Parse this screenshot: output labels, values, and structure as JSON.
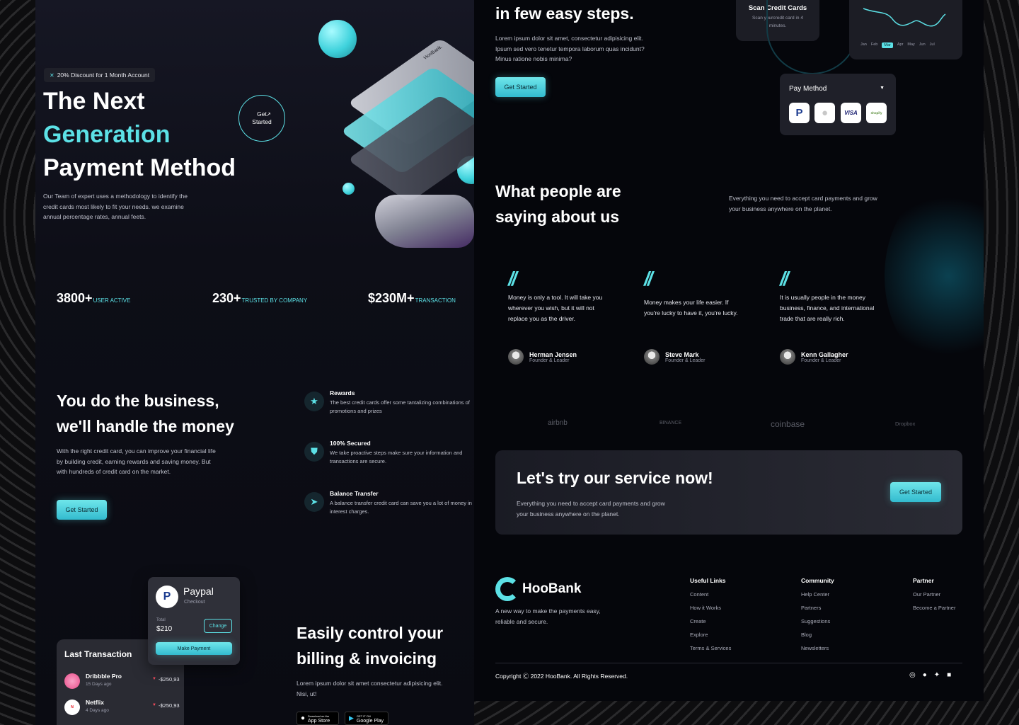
{
  "hero": {
    "badge": "20% Discount for 1 Month Account",
    "title_line1": "The Next",
    "title_line2": "Generation",
    "title_line3": "Payment Method",
    "description": "Our Team of expert uses a methodology to identify the credit cards most likely to fit your needs. we examine annual percentage rates, annual feets.",
    "circle_button": "Get Started",
    "card_brand": "HooBank"
  },
  "stats": [
    {
      "value": "3800+",
      "label": "USER ACTIVE"
    },
    {
      "value": "230+",
      "label": "TRUSTED BY COMPANY"
    },
    {
      "value": "$230M+",
      "label": "TRANSACTION"
    }
  ],
  "business": {
    "title_line1": "You do the business,",
    "title_line2": "we'll handle the money",
    "description": "With the right credit card, you can improve your financial life by building credit, earning rewards and saving money. But with hundreds of credit card on the market.",
    "button": "Get Started"
  },
  "features": [
    {
      "icon": "star-icon",
      "title": "Rewards",
      "desc": "The best credit cards offer some tantalizing combinations of promotions and prizes"
    },
    {
      "icon": "shield-icon",
      "title": "100% Secured",
      "desc": "We take proactive steps make sure your information and transactions are secure."
    },
    {
      "icon": "send-icon",
      "title": "Balance Transfer",
      "desc": "A balance transfer credit card can save you a lot of money in interest charges."
    }
  ],
  "paypal_card": {
    "title": "Paypal",
    "subtitle": "Checkout",
    "total_label": "Total",
    "total_value": "$210",
    "change_button": "Change",
    "pay_button": "Make Payment"
  },
  "last_transaction": {
    "title": "Last Transaction",
    "items": [
      {
        "name": "Dribbble Pro",
        "time": "15 Days ago",
        "amount": "-$250,93"
      },
      {
        "name": "Netflix",
        "time": "4 Days ago",
        "amount": "-$250,93"
      }
    ]
  },
  "billing": {
    "title_line1": "Easily control your",
    "title_line2": "billing & invoicing",
    "description": "Lorem ipsum dolor sit amet consectetur adipisicing elit. Nisi, ut!",
    "app_store_small": "Download on the",
    "app_store": "App Store",
    "google_play_small": "GET IT ON",
    "google_play": "Google Play"
  },
  "steps": {
    "title": "in few easy steps.",
    "description": "Lorem ipsum dolor sit amet, consectetur adipisicing elit. Ipsum sed vero tenetur tempora laborum quas incidunt? Minus ratione nobis minima?",
    "button": "Get Started"
  },
  "scan_card": {
    "title": "Scan Credit Cards",
    "desc": "Scan yourcredit card in 4 minutes."
  },
  "mini_chart": {
    "months": [
      "Jan",
      "Feb",
      "Mar",
      "Apr",
      "May",
      "Jun",
      "Jul"
    ],
    "active": "Mar"
  },
  "pay_method": {
    "title": "Pay Method",
    "methods": [
      "paypal-icon",
      "apple-icon",
      "visa-icon",
      "shopify-icon"
    ],
    "visa_text": "VISA",
    "shopify_text": "shopify"
  },
  "testimonials": {
    "title_line1": "What people are",
    "title_line2": "saying about us",
    "side_text": "Everything you need to accept card payments and grow your business anywhere on the planet.",
    "items": [
      {
        "text": "Money is only a tool. It will take you wherever you wish, but it will not replace you as the driver.",
        "name": "Herman Jensen",
        "role": "Founder & Leader"
      },
      {
        "text": "Money makes your life easier. If you're lucky to have it, you're lucky.",
        "name": "Steve Mark",
        "role": "Founder & Leader"
      },
      {
        "text": "It is usually people in the money business, finance, and international trade that are really rich.",
        "name": "Kenn Gallagher",
        "role": "Founder & Leader"
      }
    ]
  },
  "partners": [
    "airbnb",
    "BINANCE",
    "coinbase",
    "Dropbox"
  ],
  "cta": {
    "title": "Let's try our service now!",
    "description": "Everything you need to accept card payments and grow your business anywhere on the planet.",
    "button": "Get Started"
  },
  "footer": {
    "brand": "HooBank",
    "tagline": "A new way to make the payments easy, reliable and secure.",
    "columns": [
      {
        "title": "Useful Links",
        "links": [
          "Content",
          "How it Works",
          "Create",
          "Explore",
          "Terms & Services"
        ]
      },
      {
        "title": "Community",
        "links": [
          "Help Center",
          "Partners",
          "Suggestions",
          "Blog",
          "Newsletters"
        ]
      },
      {
        "title": "Partner",
        "links": [
          "Our Partner",
          "Become a Partner"
        ]
      }
    ],
    "copyright": "Copyright Ⓒ 2022 HooBank. All Rights Reserved.",
    "social": [
      "instagram-icon",
      "facebook-icon",
      "twitter-icon",
      "linkedin-icon"
    ]
  },
  "colors": {
    "accent": "#5ce1e6",
    "background": "#0b0c14",
    "card": "#2a2b33"
  }
}
